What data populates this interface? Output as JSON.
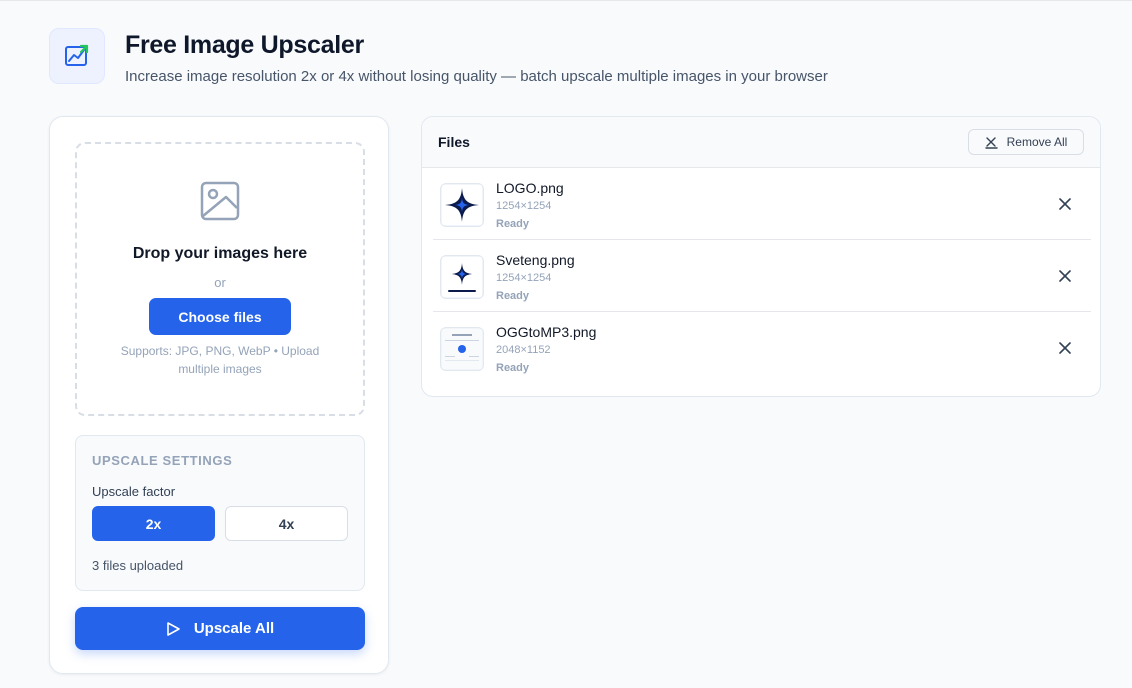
{
  "header": {
    "title": "Free Image Upscaler",
    "subtitle": "Increase image resolution 2x or 4x without losing quality — batch upscale multiple images in your browser",
    "logo_icon": "chart-trend-icon"
  },
  "dropzone": {
    "icon": "image-icon",
    "title": "Drop your images here",
    "or": "or",
    "button_label": "Choose files",
    "support_text": "Supports: JPG, PNG, WebP • Upload multiple images"
  },
  "settings": {
    "heading": "UPSCALE SETTINGS",
    "factor_label": "Upscale factor",
    "factors": [
      {
        "label": "2x",
        "selected": true
      },
      {
        "label": "4x",
        "selected": false
      }
    ],
    "files_count": "3 files uploaded"
  },
  "upscale_button": {
    "label": "Upscale All",
    "icon": "play-icon"
  },
  "files_panel": {
    "title": "Files",
    "remove_all_label": "Remove All",
    "files": [
      {
        "name": "LOGO.png",
        "dimensions": "1254×1254",
        "status": "Ready"
      },
      {
        "name": "Sveteng.png",
        "dimensions": "1254×1254",
        "status": "Ready"
      },
      {
        "name": "OGGtoMP3.png",
        "dimensions": "2048×1152",
        "status": "Ready"
      }
    ]
  },
  "colors": {
    "accent": "#2563eb",
    "background": "#f8fafc",
    "muted_text": "#94a3b8"
  }
}
